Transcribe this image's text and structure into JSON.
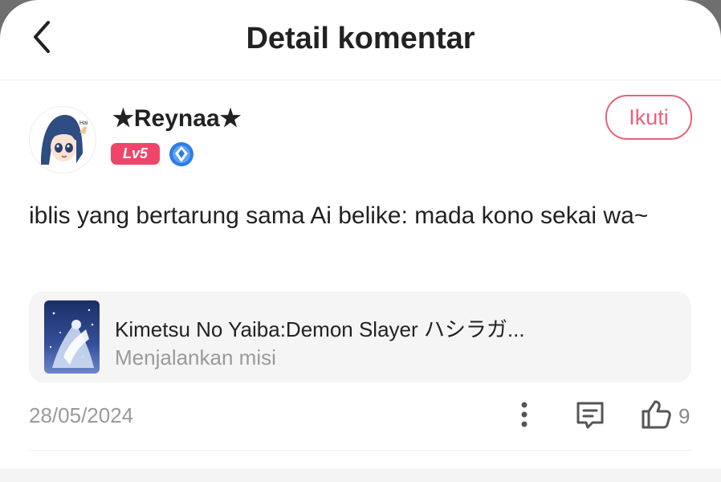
{
  "header": {
    "title": "Detail komentar",
    "back_icon": "chevron-left-icon"
  },
  "user": {
    "name": "★Reynaa★",
    "level": "Lv5",
    "avatar_caption": "Hai",
    "verified_icon": "verified-badge-icon",
    "follow_label": "Ikuti"
  },
  "comment": {
    "text": "iblis yang bertarung sama Ai belike: mada kono sekai wa~",
    "date": "28/05/2024",
    "likes": "9"
  },
  "game": {
    "title": "Kimetsu No Yaiba:Demon Slayer ハシラガ...",
    "status": "Menjalankan misi"
  },
  "actions": {
    "more_icon": "more-vertical-icon",
    "reply_icon": "comment-icon",
    "like_icon": "thumbs-up-icon"
  },
  "colors": {
    "accent": "#e8627a",
    "level_badge": "#f0456a",
    "verified": "#2f7be5",
    "muted_text": "#9a9a9a"
  }
}
